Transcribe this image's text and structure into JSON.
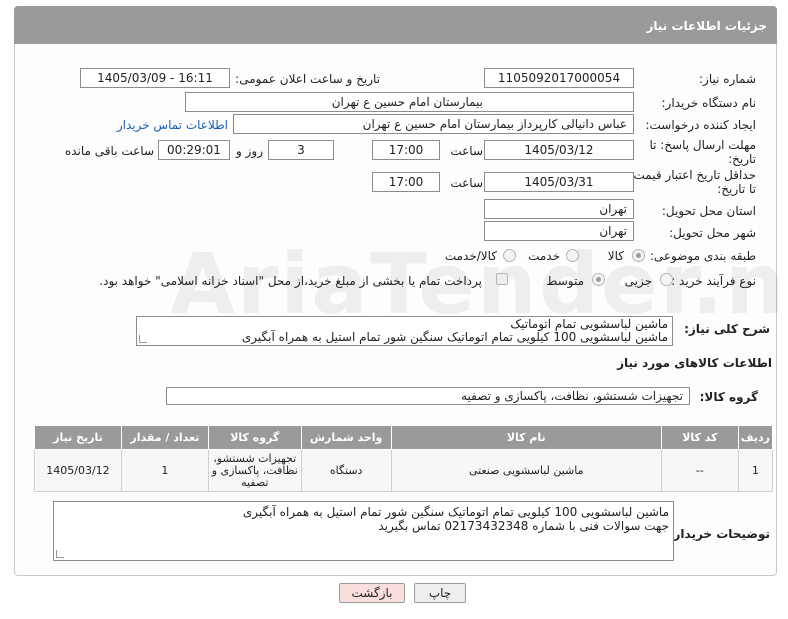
{
  "header": {
    "title": "جزئیات اطلاعات نیاز"
  },
  "fields": {
    "need_number_label": "شماره نیاز:",
    "need_number": "1105092017000054",
    "announce_label": "تاریخ و ساعت اعلان عمومی:",
    "announce_value": "1405/03/09 - 16:11",
    "buyer_org_label": "نام دستگاه خریدار:",
    "buyer_org": "بیمارستان امام حسین  ع  تهران",
    "creator_label": "ایجاد کننده درخواست:",
    "creator": "عباس دانیالی کارپرداز بیمارستان امام حسین  ع  تهران",
    "buyer_contact_link": "اطلاعات تماس خریدار",
    "reply_deadline_label_1": "مهلت ارسال پاسخ: تا",
    "reply_deadline_label_2": "تاریخ:",
    "reply_date": "1405/03/12",
    "time_label": "ساعت",
    "reply_time": "17:00",
    "days": "3",
    "days_label": "روز و",
    "remaining_time": "00:29:01",
    "remaining_label": "ساعت باقی مانده",
    "price_validity_label_1": "حداقل تاریخ اعتبار قیمت:",
    "price_validity_label_2": "تا تاریخ:",
    "price_date": "1405/03/31",
    "price_time": "17:00",
    "province_label": "استان محل تحویل:",
    "province": "تهران",
    "city_label": "شهر محل تحویل:",
    "city": "تهران",
    "category_label": "طبقه بندی موضوعی:",
    "category_options": [
      "کالا",
      "خدمت",
      "کالا/خدمت"
    ],
    "process_label": "نوع فرآیند خرید :",
    "process_options": [
      "جزیی",
      "متوسط"
    ],
    "payment_note": "پرداخت تمام یا بخشی از مبلغ خرید،از محل \"اسناد خزانه اسلامی\" خواهد بود."
  },
  "description": {
    "label": "شرح کلی نیاز:",
    "line1": "ماشین لباسشویی تمام اتوماتیک",
    "line2": "ماشین لباسشویی 100 کیلویی تمام اتوماتیک سنگین شور تمام استیل به همراه آبگیری"
  },
  "goods_section": {
    "title": "اطلاعات کالاهای مورد نیاز",
    "group_label": "گروه کالا:",
    "group_value": "تجهیزات شستشو، نظافت، پاکسازی و تصفیه"
  },
  "table": {
    "headers": [
      "ردیف",
      "کد کالا",
      "نام کالا",
      "واحد شمارش",
      "گروه کالا",
      "تعداد / مقدار",
      "تاریخ نیاز"
    ],
    "rows": [
      {
        "row": "1",
        "code": "--",
        "name": "ماشین لباسشویی صنعتی",
        "unit": "دستگاه",
        "group": "تجهیزات شستشو، نظافت، پاکسازی و تصفیه",
        "qty": "1",
        "date": "1405/03/12"
      }
    ]
  },
  "buyer_notes": {
    "label": "توضیحات خریدار:",
    "line1": "ماشین لباسشویی 100 کیلویی تمام اتوماتیک سنگین شور تمام استیل به همراه آبگیری",
    "line2": "جهت سوالات فنی با شماره 02173432348 تماس بگیرید"
  },
  "buttons": {
    "print": "چاپ",
    "back": "بازگشت"
  },
  "watermark": "AriaTender.neT",
  "colors": {
    "header_bg": "#9a9a9a",
    "link": "#1a5fb4",
    "back_btn_bg": "#f9dede",
    "print_btn_bg": "#eeeeee"
  }
}
